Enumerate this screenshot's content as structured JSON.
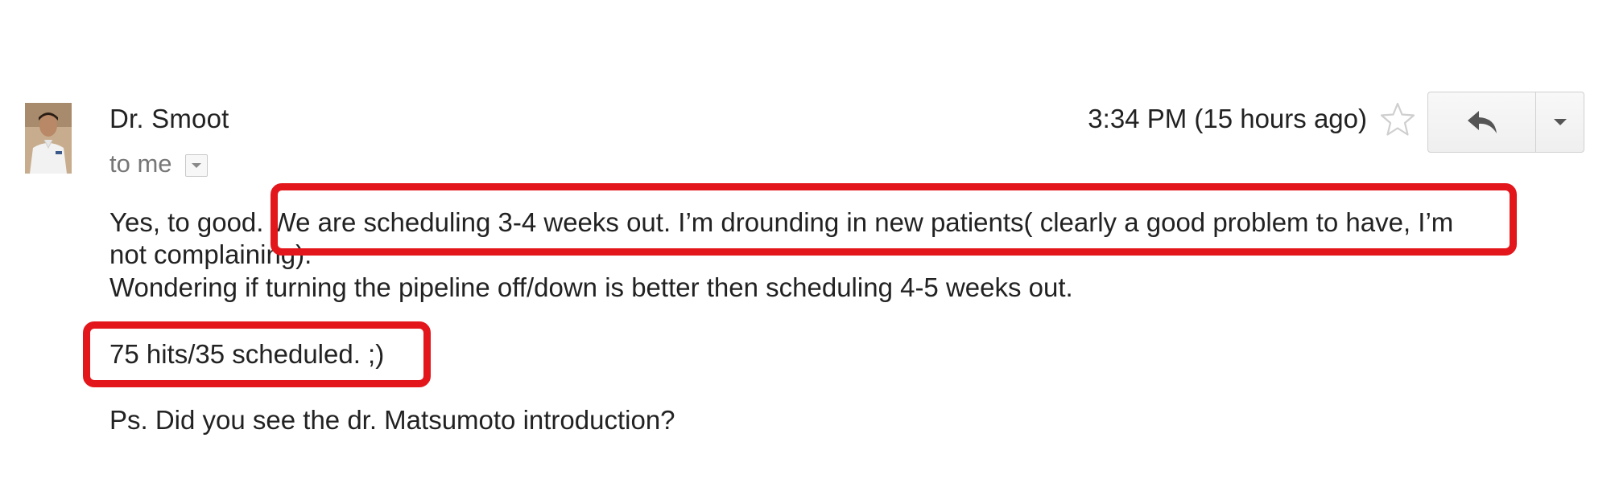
{
  "message": {
    "sender_name": "Dr. Smoot",
    "recipient": "to me",
    "timestamp": "3:34 PM (15 hours ago)",
    "icons": {
      "avatar": "sender-avatar-photo",
      "star": "star-outline-icon",
      "reply": "reply-arrow-icon",
      "more": "dropdown-caret-icon",
      "recipient_details": "small-caret-icon"
    },
    "body": {
      "line1": "Yes, to good.  We are scheduling 3-4 weeks out.  I’m drounding in new patients( clearly a good problem to have, I’m",
      "line2": "not complaining).",
      "line3": "Wondering if turning the pipeline off/down is better then scheduling 4-5 weeks out.",
      "line4": "75 hits/35 scheduled. ;)",
      "line5": "Ps. Did you see the dr. Matsumoto introduction?"
    },
    "annotation_color": "#e3171b"
  }
}
